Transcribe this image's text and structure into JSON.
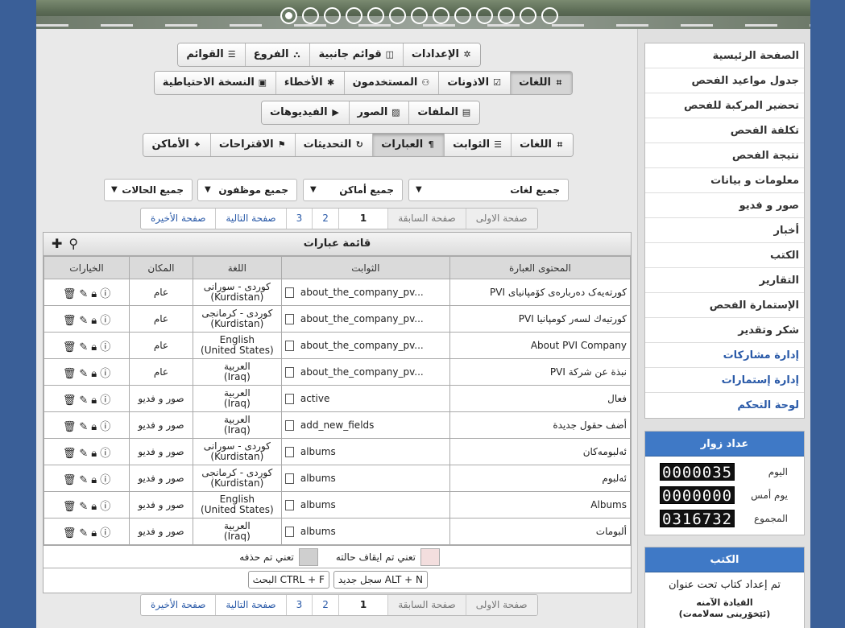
{
  "slider": {
    "dots": 13,
    "active": 0
  },
  "toolbar1": [
    "الإعدادات",
    "قوائم جانبية",
    "الفروع",
    "القوائم"
  ],
  "toolbar2": [
    "اللغات",
    "الاذونات",
    "المستخدمون",
    "الأخطاء",
    "النسخة الاحتياطية"
  ],
  "toolbar3": [
    "الملفات",
    "الصور",
    "الفيديوهات"
  ],
  "toolbar4": [
    "اللغات",
    "الثوابت",
    "العبارات",
    "التحديثات",
    "الاقتراحات",
    "الأماكن"
  ],
  "filters": {
    "languages": "جميع لغات",
    "places": "جميع أماكن",
    "employees": "جميع موظفون",
    "statuses": "جميع الحالات"
  },
  "pager": {
    "first": "صفحة الاولى",
    "prev": "صفحة السابقة",
    "current": "1",
    "p2": "2",
    "p3": "3",
    "next": "صفحة التالية",
    "last": "صفحة الأخيرة"
  },
  "panel": {
    "title": "قائمة عبارات"
  },
  "table": {
    "headers": {
      "content": "المحتوى العبارة",
      "const": "الثوابت",
      "lang": "اللغة",
      "place": "المكان",
      "options": "الخيارات"
    },
    "rows": [
      {
        "content": "كورتەیەک دەربارەی کۆمپانیای PVI",
        "const": "about_the_company_pv...",
        "lang1": "كوردى - سورانى",
        "lang2": "(Kurdistan)",
        "place": "عام"
      },
      {
        "content": "كورتيەك لسەر كومپانيا PVI",
        "const": "about_the_company_pv...",
        "lang1": "كوردى - كرمانجى",
        "lang2": "(Kurdistan)",
        "place": "عام"
      },
      {
        "content": "About PVI Company",
        "const": "about_the_company_pv...",
        "lang1": "English",
        "lang2": "(United States)",
        "place": "عام"
      },
      {
        "content": "نبذة عن شركة PVI",
        "const": "about_the_company_pv...",
        "lang1": "العربية",
        "lang2": "(Iraq)",
        "place": "عام"
      },
      {
        "content": "فعال",
        "const": "active",
        "lang1": "العربية",
        "lang2": "(Iraq)",
        "place": "صور و فديو"
      },
      {
        "content": "أضف حقول جديدة",
        "const": "add_new_fields",
        "lang1": "العربية",
        "lang2": "(Iraq)",
        "place": "صور و فديو"
      },
      {
        "content": "ئەلبومەکان",
        "const": "albums",
        "lang1": "كوردى - سورانى",
        "lang2": "(Kurdistan)",
        "place": "صور و فديو"
      },
      {
        "content": "ئەلبوم",
        "const": "albums",
        "lang1": "كوردى - كرمانجى",
        "lang2": "(Kurdistan)",
        "place": "صور و فديو"
      },
      {
        "content": "Albums",
        "const": "albums",
        "lang1": "English",
        "lang2": "(United States)",
        "place": "صور و فديو"
      },
      {
        "content": "ألبومات",
        "const": "albums",
        "lang1": "العربية",
        "lang2": "(Iraq)",
        "place": "صور و فديو"
      }
    ]
  },
  "legend": {
    "stopped": "تعني تم ايقاف حالته",
    "deleted": "تعني تم حذفه",
    "stopped_color": "#f3dede",
    "deleted_color": "#cfcfcf"
  },
  "shortcuts": {
    "new": "ALT + N سجل جديد",
    "search": "CTRL + F البحث"
  },
  "side_menu": [
    {
      "label": "الصفحة الرئيسية",
      "blue": false
    },
    {
      "label": "جدول مواعيد الفحص",
      "blue": false
    },
    {
      "label": "تحضير المركبة للفحص",
      "blue": false
    },
    {
      "label": "تكلفة الفحص",
      "blue": false
    },
    {
      "label": "نتيجة الفحص",
      "blue": false
    },
    {
      "label": "معلومات و بيانات",
      "blue": false
    },
    {
      "label": "صور و فديو",
      "blue": false
    },
    {
      "label": "أخبار",
      "blue": false
    },
    {
      "label": "الكتب",
      "blue": false
    },
    {
      "label": "التقارير",
      "blue": false
    },
    {
      "label": "الإستمارة الفحص",
      "blue": false
    },
    {
      "label": "شكر وتقدير",
      "blue": false
    },
    {
      "label": "إدارة مشاركات",
      "blue": true
    },
    {
      "label": "إدارة إستمارات",
      "blue": true
    },
    {
      "label": "لوحة التحكم",
      "blue": true
    }
  ],
  "visitors": {
    "title": "عداد زوار",
    "today_label": "اليوم",
    "today": "0000035",
    "yesterday_label": "يوم أمس",
    "yesterday": "0000000",
    "total_label": "المجموع",
    "total": "0316732"
  },
  "books": {
    "title": "الكتب",
    "line": "تم إعداد كتاب تحت عنوان",
    "sub1": "القيادة الآمنه",
    "sub2": "(ئێخۆرینی سەلامەت)"
  },
  "colors": {
    "accent": "#3f79c6",
    "link": "#2a5aa8",
    "bg": "#3a5f98"
  }
}
